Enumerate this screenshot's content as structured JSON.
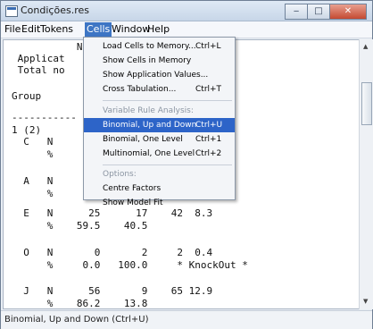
{
  "window": {
    "title": "Condições.res",
    "minimize": "‒",
    "maximize": "□",
    "close": "✕"
  },
  "menubar": {
    "items": [
      "File",
      "Edit",
      "Tokens",
      "Cells",
      "Window",
      "Help"
    ]
  },
  "content": {
    "lines": [
      "           Num",
      " Applicat",
      " Total no",
      "",
      "Group                            %",
      "",
      "-----------                    -----",
      "1 (2)",
      "  C   N                      22.1",
      "      %",
      "",
      "  A   N                      44.3",
      "      %",
      "",
      "  E   N      25      17    42  8.3",
      "      %    59.5    40.5",
      "",
      "  O   N       0       2     2  0.4",
      "      %     0.0   100.0     * KnockOut *",
      "",
      "  J   N      56       9    65 12.9",
      "      %    86.2    13.8"
    ]
  },
  "dropdown": {
    "items": [
      {
        "label": "Load Cells to Memory...",
        "shortcut": "Ctrl+L",
        "disabled": false
      },
      {
        "label": "Show Cells in Memory",
        "shortcut": "",
        "disabled": false
      },
      {
        "label": "Show Application Values...",
        "shortcut": "",
        "disabled": false
      },
      {
        "label": "Cross Tabulation...",
        "shortcut": "Ctrl+T",
        "disabled": false
      },
      {
        "label": "Variable Rule Analysis:",
        "shortcut": "",
        "disabled": true
      },
      {
        "label": "Binomial, Up and Down",
        "shortcut": "Ctrl+U",
        "disabled": false,
        "highlighted": true
      },
      {
        "label": "Binomial, One Level",
        "shortcut": "Ctrl+1",
        "disabled": false
      },
      {
        "label": "Multinomial, One Level",
        "shortcut": "Ctrl+2",
        "disabled": false
      },
      {
        "label": "Options:",
        "shortcut": "",
        "disabled": true
      },
      {
        "label": "Centre Factors",
        "shortcut": "",
        "disabled": false
      },
      {
        "label": "Show Model Fit",
        "shortcut": "",
        "disabled": false
      }
    ]
  },
  "statusbar": {
    "text": "Binomial, Up and Down (Ctrl+U)"
  }
}
